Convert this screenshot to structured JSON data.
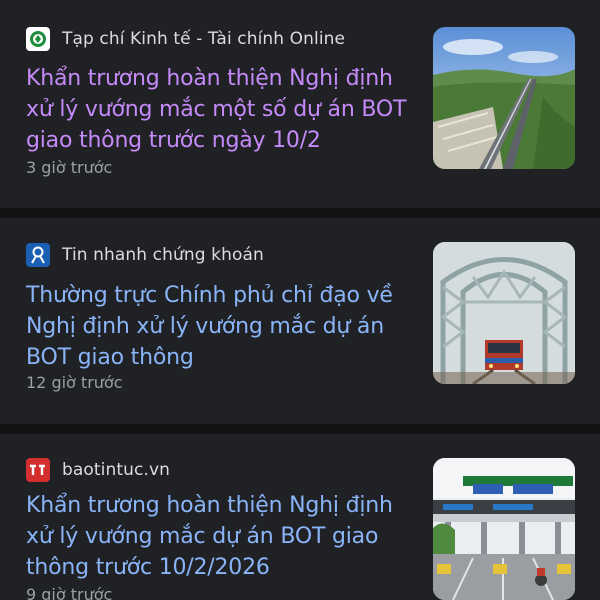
{
  "feed": {
    "articles": [
      {
        "source": "Tạp chí Kinh tế - Tài chính Online",
        "favicon_icon": "green-circle-logo-icon",
        "headline": "Khẩn trương hoàn thiện Nghị định xử lý vướng mắc một số dự án BOT giao thông trước ngày 10/2",
        "time": "3 giờ trước",
        "visited": true,
        "thumbnail": "highway-aerial-image"
      },
      {
        "source": "Tin nhanh chứng khoán",
        "favicon_icon": "blue-person-logo-icon",
        "headline": "Thường trực Chính phủ chỉ đạo về Nghị định xử lý vướng mắc dự án BOT giao thông",
        "time": "12 giờ trước",
        "visited": false,
        "thumbnail": "railway-bridge-train-image"
      },
      {
        "source": "baotintuc.vn",
        "favicon_icon": "red-tt-logo-icon",
        "headline": "Khẩn trương hoàn thiện Nghị định xử lý vướng mắc dự án BOT giao thông trước 10/2/2026",
        "time": "9 giờ trước",
        "visited": false,
        "thumbnail": "toll-station-image"
      }
    ]
  },
  "colors": {
    "background": "#121212",
    "card": "#202124",
    "visited_link": "#c58af9",
    "link": "#8ab4f8",
    "meta_text": "#9aa0a6",
    "source_text": "#dcdcdc"
  }
}
